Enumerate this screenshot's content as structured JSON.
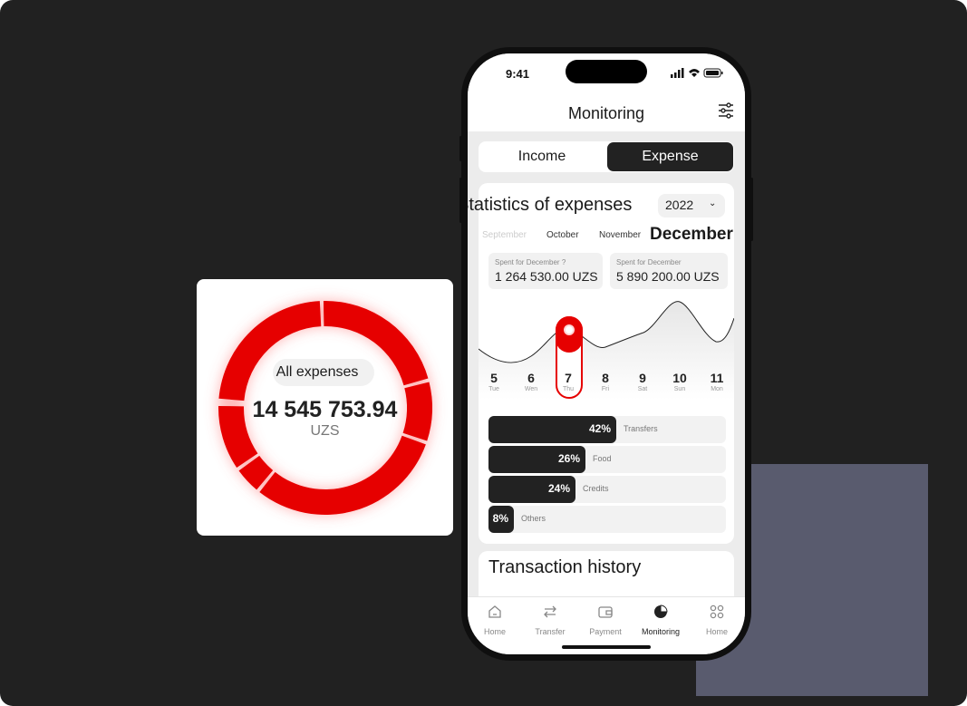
{
  "donut": {
    "label": "All expenses",
    "value": "14 545 753.94",
    "currency": "UZS",
    "color": "#e60000"
  },
  "status": {
    "time": "9:41"
  },
  "header": {
    "title": "Monitoring",
    "filter_icon": "sliders-icon"
  },
  "tabs": {
    "income": "Income",
    "expense": "Expense",
    "selected": "Expense"
  },
  "stats": {
    "title": "Statistics of expenses",
    "year": "2022",
    "months": [
      "September",
      "October",
      "November",
      "December"
    ],
    "selected_month": "December",
    "spent_prev": {
      "label": "Spent for December ?",
      "value": "1 264 530.00 UZS"
    },
    "spent_current": {
      "label": "Spent for December",
      "value": "5 890 200.00 UZS"
    }
  },
  "chart_data": {
    "type": "line",
    "x": [
      "5",
      "6",
      "7",
      "8",
      "9",
      "10",
      "11"
    ],
    "weekday_labels": [
      "Tue",
      "Wen",
      "Thu",
      "Fri",
      "Sat",
      "Sun",
      "Mon"
    ],
    "selected_day": "7"
  },
  "days": [
    {
      "num": "5",
      "dow": "Tue"
    },
    {
      "num": "6",
      "dow": "Wen"
    },
    {
      "num": "7",
      "dow": "Thu"
    },
    {
      "num": "8",
      "dow": "Fri"
    },
    {
      "num": "9",
      "dow": "Sat"
    },
    {
      "num": "10",
      "dow": "Sun"
    },
    {
      "num": "11",
      "dow": "Mon"
    }
  ],
  "categories": [
    {
      "pct": "42%",
      "name": "Transfers",
      "fraction": 0.42
    },
    {
      "pct": "26%",
      "name": "Food",
      "fraction": 0.26
    },
    {
      "pct": "24%",
      "name": "Credits",
      "fraction": 0.24
    },
    {
      "pct": "8%",
      "name": "Others",
      "fraction": 0.08
    }
  ],
  "history": {
    "title": "Transaction history"
  },
  "nav": [
    {
      "label": "Home",
      "icon": "home-icon"
    },
    {
      "label": "Transfer",
      "icon": "transfer-icon"
    },
    {
      "label": "Payment",
      "icon": "wallet-icon"
    },
    {
      "label": "Monitoring",
      "icon": "pie-chart-icon"
    },
    {
      "label": "Home",
      "icon": "grid-icon"
    }
  ],
  "nav_active": "Monitoring"
}
